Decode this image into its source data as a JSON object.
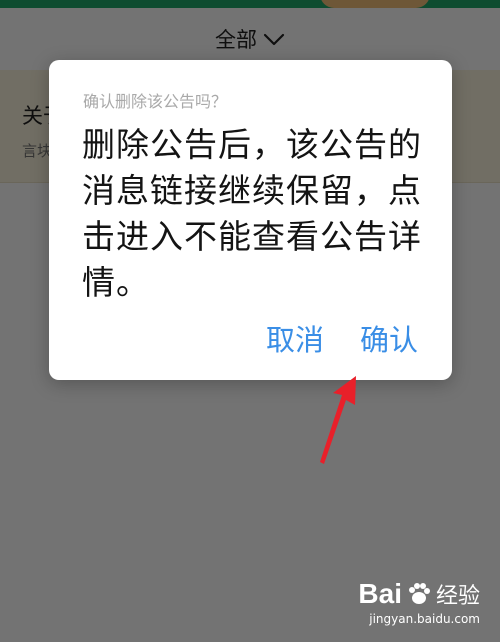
{
  "page": {
    "filter_label": "全部",
    "notice_title": "关于",
    "notice_subtitle": "言块"
  },
  "dialog": {
    "title": "确认删除该公告吗？",
    "message": "删除公告后，该公告的消息链接继续保留，点击进入不能查看公告详情。",
    "cancel_label": "取消",
    "confirm_label": "确认"
  },
  "watermark": {
    "brand": "Bai",
    "brand_suffix": "经验",
    "url": "jingyan.baidu.com"
  },
  "colors": {
    "accent": "#3a8ee6",
    "overlay": "rgba(0,0,0,0.55)",
    "annotation_arrow": "#e8202a",
    "notice_background": "#fbf3dd"
  },
  "icons": [
    "chevron-down-icon",
    "red-arrow-annotation",
    "baidu-paw-icon"
  ]
}
